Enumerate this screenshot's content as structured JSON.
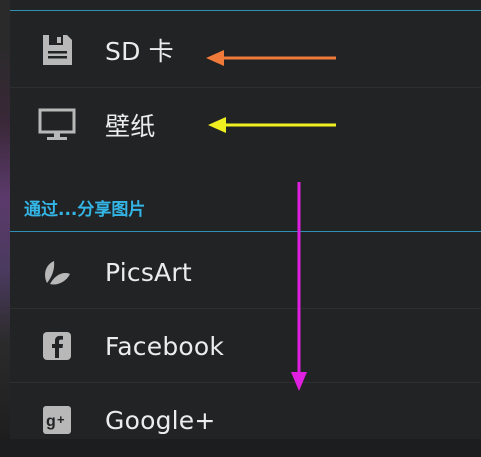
{
  "menu": {
    "save_items": [
      {
        "label": "SD 卡",
        "icon": "sd-card-icon"
      },
      {
        "label": "壁纸",
        "icon": "monitor-icon"
      }
    ],
    "share_header": "通过...分享图片",
    "share_items": [
      {
        "label": "PicsArt",
        "icon": "picsart-icon"
      },
      {
        "label": "Facebook",
        "icon": "facebook-icon"
      },
      {
        "label": "Google+",
        "icon": "google-plus-icon"
      }
    ]
  },
  "colors": {
    "accent": "#33b5e5",
    "arrow_orange": "#f07a3a",
    "arrow_yellow": "#f0f020",
    "arrow_magenta": "#e020e0",
    "icon_gray": "#b8b8b8"
  }
}
